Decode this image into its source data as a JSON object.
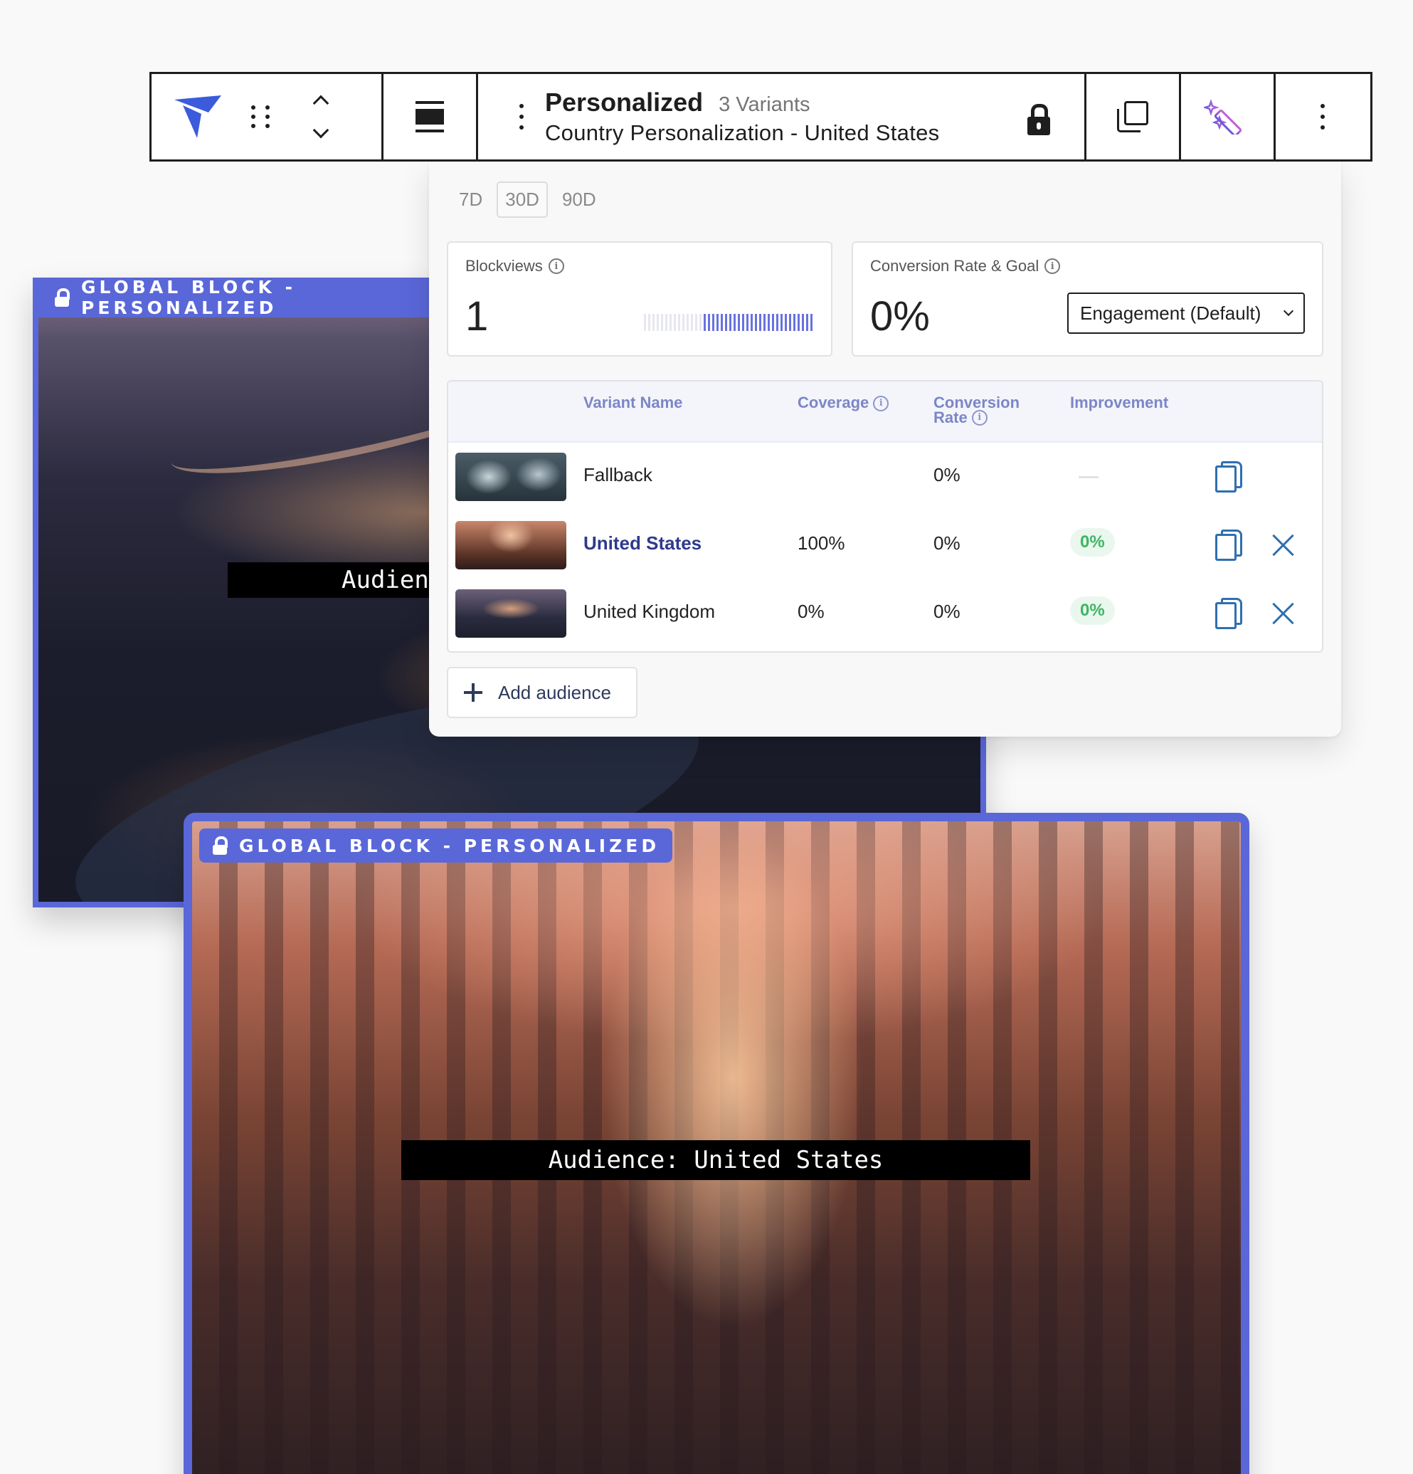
{
  "toolbar": {
    "title": "Personalized",
    "variants": "3 Variants",
    "subtitle": "Country Personalization - United States"
  },
  "ranges": [
    "7D",
    "30D",
    "90D"
  ],
  "active_range": "30D",
  "blockviews": {
    "label": "Blockviews",
    "value": "1",
    "sparkline_active_fraction": 0.64
  },
  "conversion": {
    "label": "Conversion Rate & Goal",
    "value": "0%",
    "goal": "Engagement (Default)"
  },
  "table": {
    "headers": {
      "name": "Variant Name",
      "coverage": "Coverage",
      "conversion_line1": "Conversion",
      "conversion_line2": "Rate",
      "improvement": "Improvement"
    },
    "rows": [
      {
        "name": "Fallback",
        "coverage": "",
        "conversion": "0%",
        "improvement": ""
      },
      {
        "name": "United States",
        "coverage": "100%",
        "conversion": "0%",
        "improvement": "0%"
      },
      {
        "name": "United Kingdom",
        "coverage": "0%",
        "conversion": "0%",
        "improvement": "0%"
      }
    ]
  },
  "add_audience": "Add audience",
  "blocks": {
    "badge": "GLOBAL BLOCK - PERSONALIZED",
    "uk_audience": "Audience: United Kingdom",
    "us_audience": "Audience: United States"
  },
  "colors": {
    "accent": "#5a67d8",
    "link_blue": "#2f6fb0",
    "positive_green": "#3fb564"
  }
}
